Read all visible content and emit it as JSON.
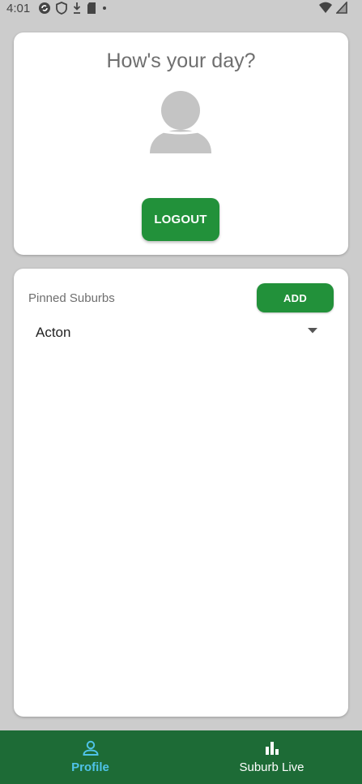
{
  "status_bar": {
    "time": "4:01",
    "left_icons": [
      "sync-icon",
      "shield-icon",
      "download-icon",
      "sd-card-icon",
      "dot-icon"
    ],
    "right_icons": [
      "wifi-icon",
      "signal-icon"
    ]
  },
  "profile_card": {
    "greeting": "How's your day?",
    "avatar_icon": "person-icon",
    "logout_label": "LOGOUT"
  },
  "pinned_card": {
    "label": "Pinned Suburbs",
    "add_label": "ADD",
    "selected_suburb": "Acton",
    "dropdown_icon": "caret-down-icon"
  },
  "bottom_nav": {
    "items": [
      {
        "label": "Profile",
        "icon": "person-outline-icon",
        "active": true
      },
      {
        "label": "Suburb Live",
        "icon": "bar-chart-icon",
        "active": false
      }
    ]
  },
  "colors": {
    "background": "#cccccc",
    "accent_green": "#22913a",
    "nav_green": "#1d6b36",
    "active_nav": "#4fc3e8"
  }
}
